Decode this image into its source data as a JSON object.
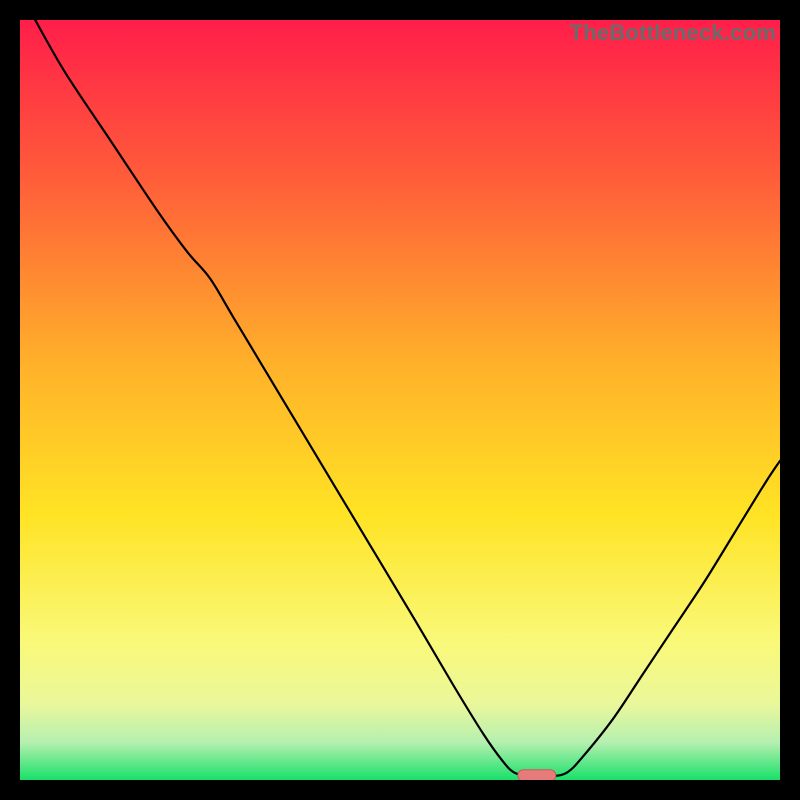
{
  "watermark": {
    "text": "TheBottleneck.com"
  },
  "chart_data": {
    "type": "line",
    "title": "",
    "xlabel": "",
    "ylabel": "",
    "xlim": [
      0,
      100
    ],
    "ylim": [
      0,
      100
    ],
    "grid": false,
    "legend": false,
    "background_gradient": {
      "stops": [
        {
          "offset": 0.0,
          "color": "#ff1e4a"
        },
        {
          "offset": 0.2,
          "color": "#ff5a3a"
        },
        {
          "offset": 0.45,
          "color": "#ffb02a"
        },
        {
          "offset": 0.65,
          "color": "#ffe324"
        },
        {
          "offset": 0.82,
          "color": "#f9f97a"
        },
        {
          "offset": 0.9,
          "color": "#eaf79a"
        },
        {
          "offset": 0.95,
          "color": "#b6f0b0"
        },
        {
          "offset": 1.0,
          "color": "#19e06a"
        }
      ]
    },
    "series": [
      {
        "name": "bottleneck-curve",
        "color": "#000000",
        "width": 2.2,
        "points": [
          {
            "x": 2,
            "y": 100
          },
          {
            "x": 6,
            "y": 93
          },
          {
            "x": 12,
            "y": 84
          },
          {
            "x": 18,
            "y": 75
          },
          {
            "x": 22,
            "y": 69.5
          },
          {
            "x": 25,
            "y": 66
          },
          {
            "x": 28,
            "y": 61
          },
          {
            "x": 34,
            "y": 51
          },
          {
            "x": 40,
            "y": 41
          },
          {
            "x": 46,
            "y": 31
          },
          {
            "x": 52,
            "y": 21
          },
          {
            "x": 57,
            "y": 12.5
          },
          {
            "x": 61,
            "y": 6
          },
          {
            "x": 63.5,
            "y": 2.5
          },
          {
            "x": 65,
            "y": 1
          },
          {
            "x": 67,
            "y": 0.5
          },
          {
            "x": 70,
            "y": 0.5
          },
          {
            "x": 72,
            "y": 1
          },
          {
            "x": 74,
            "y": 3
          },
          {
            "x": 78,
            "y": 8
          },
          {
            "x": 82,
            "y": 14
          },
          {
            "x": 86,
            "y": 20
          },
          {
            "x": 90,
            "y": 26
          },
          {
            "x": 94,
            "y": 32.5
          },
          {
            "x": 98,
            "y": 39
          },
          {
            "x": 100,
            "y": 42
          }
        ]
      }
    ],
    "marker": {
      "name": "optimal-zone",
      "color_fill": "#e77a7a",
      "color_stroke": "#cc5a5a",
      "shape": "pill",
      "x_center": 68,
      "y": 0.6,
      "width_x": 5,
      "height_y": 1.5
    }
  }
}
